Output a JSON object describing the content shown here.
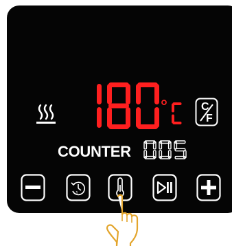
{
  "display": {
    "temperature": "180",
    "unit": "°C",
    "counter_label": "COUNTER",
    "counter_value": "005"
  },
  "buttons": {
    "cf_toggle": "C/F",
    "decrease": "minus-icon",
    "timer": "timer-icon",
    "temperature": "thermometer-icon",
    "play_pause": "play-pause-icon",
    "increase": "plus-icon"
  },
  "colors": {
    "panel": "#050505",
    "segment_red": "#ff1f1f",
    "icon_white": "#ffffff",
    "hand_outline": "#e3a52c"
  }
}
